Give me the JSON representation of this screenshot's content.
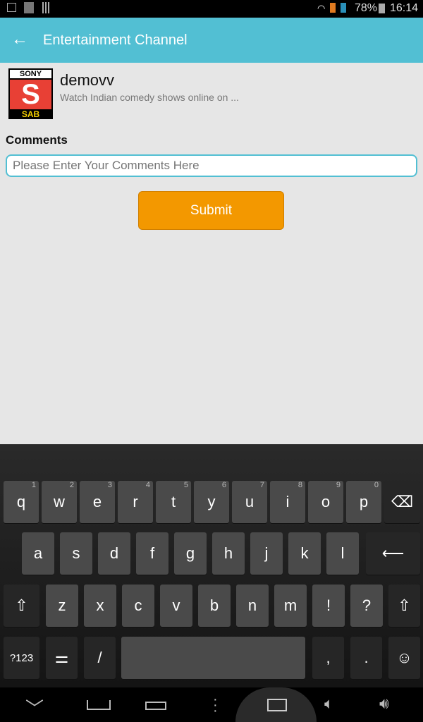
{
  "status_bar": {
    "battery": "78%",
    "time": "16:14"
  },
  "app_bar": {
    "title": "Entertainment Channel"
  },
  "channel": {
    "name": "demovv",
    "description": "Watch Indian comedy shows online on ...",
    "logo_text_top": "SONY",
    "logo_text_bottom": "SAB"
  },
  "form": {
    "label": "Comments",
    "placeholder": "Please Enter Your Comments Here",
    "value": "",
    "submit": "Submit"
  },
  "colors": {
    "accent": "#52bfd3",
    "button": "#f39800"
  },
  "keyboard": {
    "row1": [
      [
        "q",
        "1"
      ],
      [
        "w",
        "2"
      ],
      [
        "e",
        "3"
      ],
      [
        "r",
        "4"
      ],
      [
        "t",
        "5"
      ],
      [
        "y",
        "6"
      ],
      [
        "u",
        "7"
      ],
      [
        "i",
        "8"
      ],
      [
        "o",
        "9"
      ],
      [
        "p",
        "0"
      ]
    ],
    "row2": [
      "a",
      "s",
      "d",
      "f",
      "g",
      "h",
      "j",
      "k",
      "l"
    ],
    "row3": [
      "z",
      "x",
      "c",
      "v",
      "b",
      "n",
      "m",
      "!",
      "?"
    ],
    "symbols": "?123",
    "slash": "/",
    "comma": ",",
    "period": "."
  }
}
